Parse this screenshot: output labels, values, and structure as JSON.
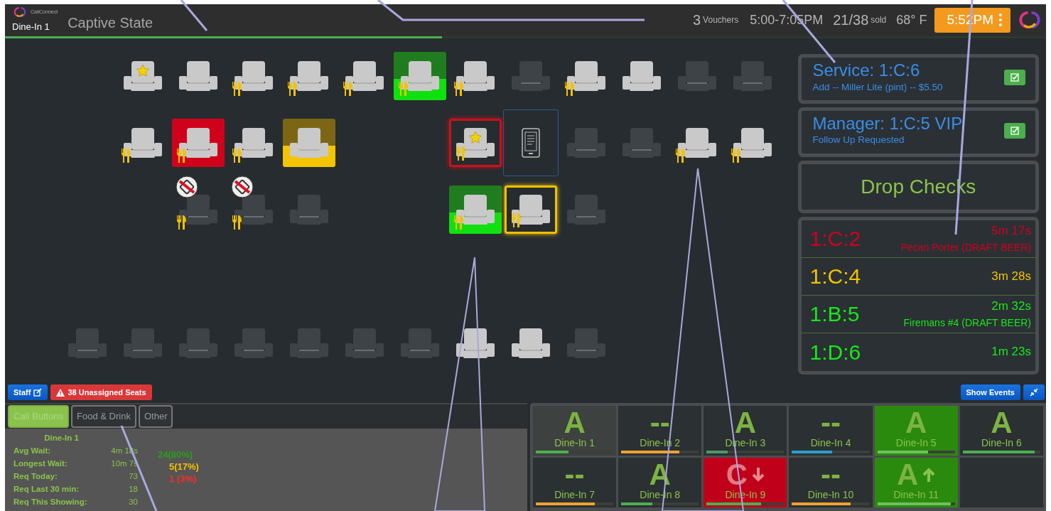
{
  "header": {
    "logo_text": "CallConnect",
    "location": "Dine-In 1",
    "title": "Captive State",
    "vouchers_count": "3",
    "vouchers_label": "Vouchers",
    "showtime": "5:00-7:05PM",
    "sold": "21/38",
    "sold_label": "sold",
    "temperature": "68° F",
    "clock": "5:52PM",
    "progress": {
      "level": 0.42
    }
  },
  "seat_map": {
    "rows": [
      {
        "spaced": false,
        "seats": [
          {
            "kind": "gap"
          },
          {
            "kind": "seat",
            "occupied": true,
            "food": false,
            "star": true,
            "no_service": false
          },
          {
            "kind": "seat",
            "occupied": true,
            "food": false,
            "star": false,
            "no_service": false
          },
          {
            "kind": "seat",
            "occupied": true,
            "food": true,
            "star": false,
            "no_service": false
          },
          {
            "kind": "seat",
            "occupied": true,
            "food": true,
            "star": false,
            "no_service": false
          },
          {
            "kind": "seat",
            "occupied": true,
            "food": true,
            "star": false,
            "no_service": false
          },
          {
            "kind": "seat",
            "occupied": true,
            "food": true,
            "star": false,
            "no_service": false,
            "highlight": {
              "kind": "split",
              "color": "#10e010"
            }
          },
          {
            "kind": "seat",
            "occupied": true,
            "food": true,
            "star": false,
            "no_service": false
          },
          {
            "kind": "seat",
            "occupied": false,
            "food": false,
            "star": false,
            "no_service": false
          },
          {
            "kind": "seat",
            "occupied": true,
            "food": true,
            "star": false,
            "no_service": false
          },
          {
            "kind": "seat",
            "occupied": true,
            "food": false,
            "star": false,
            "no_service": false
          },
          {
            "kind": "seat",
            "occupied": false,
            "food": false,
            "star": false,
            "no_service": false
          },
          {
            "kind": "seat",
            "occupied": false,
            "food": false,
            "star": false,
            "no_service": false
          }
        ]
      },
      {
        "spaced": false,
        "seats": [
          {
            "kind": "gap"
          },
          {
            "kind": "seat",
            "occupied": true,
            "food": true,
            "star": false,
            "no_service": false
          },
          {
            "kind": "seat",
            "occupied": true,
            "food": true,
            "star": false,
            "no_service": false,
            "highlight": {
              "kind": "fill",
              "color": "#d0021b"
            }
          },
          {
            "kind": "seat",
            "occupied": true,
            "food": true,
            "star": false,
            "no_service": false
          },
          {
            "kind": "seat",
            "occupied": true,
            "food": false,
            "star": false,
            "no_service": false,
            "highlight": {
              "kind": "split",
              "color": "#f5c400"
            }
          },
          {
            "kind": "gap"
          },
          {
            "kind": "gap"
          },
          {
            "kind": "seat",
            "occupied": true,
            "food": true,
            "star": true,
            "no_service": false,
            "highlight": {
              "kind": "outline",
              "color": "#c8101e"
            }
          },
          {
            "kind": "tablet"
          },
          {
            "kind": "seat",
            "occupied": false,
            "food": false,
            "star": false,
            "no_service": false
          },
          {
            "kind": "seat",
            "occupied": false,
            "food": false,
            "star": false,
            "no_service": false
          },
          {
            "kind": "seat",
            "occupied": true,
            "food": true,
            "star": false,
            "no_service": false
          },
          {
            "kind": "seat",
            "occupied": true,
            "food": true,
            "star": false,
            "no_service": false
          }
        ]
      },
      {
        "spaced": false,
        "seats": [
          {
            "kind": "gap"
          },
          {
            "kind": "gap"
          },
          {
            "kind": "seat",
            "occupied": false,
            "food": true,
            "star": false,
            "no_service": true
          },
          {
            "kind": "seat",
            "occupied": false,
            "food": true,
            "star": false,
            "no_service": true
          },
          {
            "kind": "seat",
            "occupied": false,
            "food": false,
            "star": false,
            "no_service": false
          },
          {
            "kind": "gap"
          },
          {
            "kind": "gap"
          },
          {
            "kind": "seat",
            "occupied": true,
            "food": true,
            "star": false,
            "no_service": false,
            "highlight": {
              "kind": "split",
              "color": "#10e010"
            }
          },
          {
            "kind": "seat",
            "occupied": true,
            "food": true,
            "star": false,
            "no_service": false,
            "highlight": {
              "kind": "outline",
              "color": "#f0c000"
            }
          },
          {
            "kind": "seat",
            "occupied": false,
            "food": false,
            "star": false,
            "no_service": false
          }
        ]
      },
      {
        "spaced": true,
        "seats": [
          {
            "kind": "seat",
            "occupied": false,
            "food": false,
            "star": false,
            "no_service": false
          },
          {
            "kind": "seat",
            "occupied": false,
            "food": false,
            "star": false,
            "no_service": false
          },
          {
            "kind": "seat",
            "occupied": false,
            "food": false,
            "star": false,
            "no_service": false
          },
          {
            "kind": "seat",
            "occupied": false,
            "food": false,
            "star": false,
            "no_service": false
          },
          {
            "kind": "seat",
            "occupied": false,
            "food": false,
            "star": false,
            "no_service": false
          },
          {
            "kind": "seat",
            "occupied": false,
            "food": false,
            "star": false,
            "no_service": false
          },
          {
            "kind": "seat",
            "occupied": false,
            "food": false,
            "star": false,
            "no_service": false
          },
          {
            "kind": "seat",
            "occupied": true,
            "food": false,
            "star": false,
            "no_service": false
          },
          {
            "kind": "seat",
            "occupied": true,
            "food": false,
            "star": false,
            "no_service": false
          },
          {
            "kind": "seat",
            "occupied": false,
            "food": false,
            "star": false,
            "no_service": false
          }
        ]
      }
    ]
  },
  "requests": [
    {
      "title": "Service: 1:C:6",
      "detail": "Add -- Miller Lite (pint) -- $5.50"
    },
    {
      "title": "Manager: 1:C:5 VIP",
      "detail": "Follow Up Requested"
    }
  ],
  "drop_checks": {
    "label": "Drop Checks"
  },
  "timers": [
    {
      "seat": "1:C:2",
      "time": "5m 17s",
      "item": "Pecan Porter (DRAFT BEER)",
      "color": "#d0021b"
    },
    {
      "seat": "1:C:4",
      "time": "3m 28s",
      "color": "#f2c200"
    },
    {
      "seat": "1:B:5",
      "time": "2m 32s",
      "item": "Firemans #4 (DRAFT BEER)",
      "color": "#19e619"
    },
    {
      "seat": "1:D:6",
      "time": "1m 23s",
      "color": "#19e619"
    }
  ],
  "actions": {
    "staff": "Staff",
    "unassigned": "38 Unassigned Seats",
    "show_events": "Show Events"
  },
  "stats_panel": {
    "tabs": [
      {
        "label": "Call Buttons",
        "selected": true
      },
      {
        "label": "Food & Drink",
        "selected": false
      },
      {
        "label": "Other",
        "selected": false
      }
    ],
    "title": "Dine-In 1",
    "rows": [
      {
        "label": "Avg Wait:",
        "value": "4m 18s"
      },
      {
        "label": "Longest Wait:",
        "value": "10m 7s"
      },
      {
        "label": "Req Today:",
        "value": "73"
      },
      {
        "label": "Req Last 30 min:",
        "value": "18"
      },
      {
        "label": "Req This Showing:",
        "value": "30"
      }
    ],
    "breakdown": [
      {
        "text": "24(80%)",
        "color": "#2e9e1a"
      },
      {
        "text": "5(17%)",
        "color": "#f2c200"
      },
      {
        "text": "1 (3%)",
        "color": "#ff2a2a"
      }
    ]
  },
  "tiles": [
    {
      "kind": "grey",
      "grade": "A",
      "label": "Dine-In 1",
      "level": 0.42,
      "color": "#4caf50"
    },
    {
      "kind": "dark",
      "grade": "--",
      "label": "Dine-In 2",
      "level": 0.75,
      "color": "#f0a030"
    },
    {
      "kind": "dark",
      "grade": "A",
      "label": "Dine-In 3",
      "level": 0.27,
      "color": "#4a9a6a"
    },
    {
      "kind": "dark",
      "grade": "--",
      "label": "Dine-In 4",
      "level": 0.52,
      "color": "#2aa0c8"
    },
    {
      "kind": "green",
      "grade": "A",
      "label": "Dine-In 5",
      "level": 0.65,
      "color": "#6fbf5f"
    },
    {
      "kind": "dark",
      "grade": "A",
      "label": "Dine-In 6",
      "level": 0.93,
      "color": "#4caf50"
    },
    {
      "kind": "dark",
      "grade": "--",
      "label": "Dine-In 7",
      "level": 0.76,
      "color": "#f0a030"
    },
    {
      "kind": "dark",
      "grade": "A",
      "label": "Dine-In 8",
      "level": 0.4,
      "color": "#4caf50"
    },
    {
      "kind": "red",
      "grade": "C",
      "arrow": {
        "kind": "down"
      },
      "label": "Dine-In 9",
      "level": 0.7,
      "color": "#4caf50"
    },
    {
      "kind": "dark",
      "grade": "--",
      "label": "Dine-In 10",
      "level": 0.76,
      "color": "#f0a030"
    },
    {
      "kind": "green",
      "grade": "A",
      "arrow": {
        "kind": "up"
      },
      "label": "Dine-In 11",
      "level": 0.95,
      "color": "#6fbf5f"
    }
  ]
}
